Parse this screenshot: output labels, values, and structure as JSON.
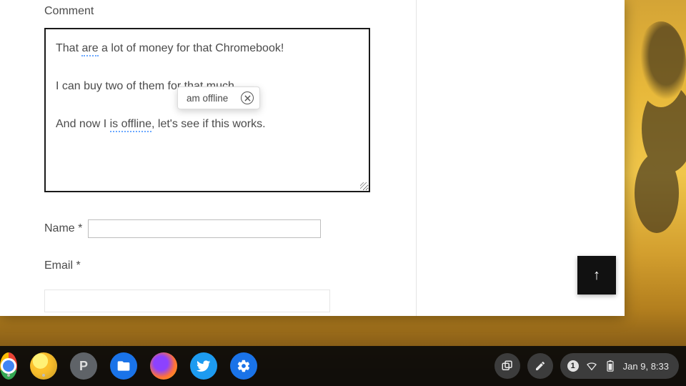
{
  "form": {
    "comment_label": "Comment",
    "comment_lines": {
      "l1a": "That ",
      "l1_err": "are",
      "l1b": " a lot of money for that Chromebook!",
      "l2": "I can buy two of them for that much.",
      "l3a": "And now I ",
      "l3_err": "is offline",
      "l3b": ", let's see if this works."
    },
    "suggestion_text": "am offline",
    "name_label": "Name *",
    "name_value": "",
    "email_label": "Email *",
    "email_value": ""
  },
  "scrolltop_glyph": "↑",
  "shelf": {
    "apps": {
      "p_letter": "P"
    },
    "notif_count": "1",
    "clock": "Jan 9, 8:33"
  }
}
